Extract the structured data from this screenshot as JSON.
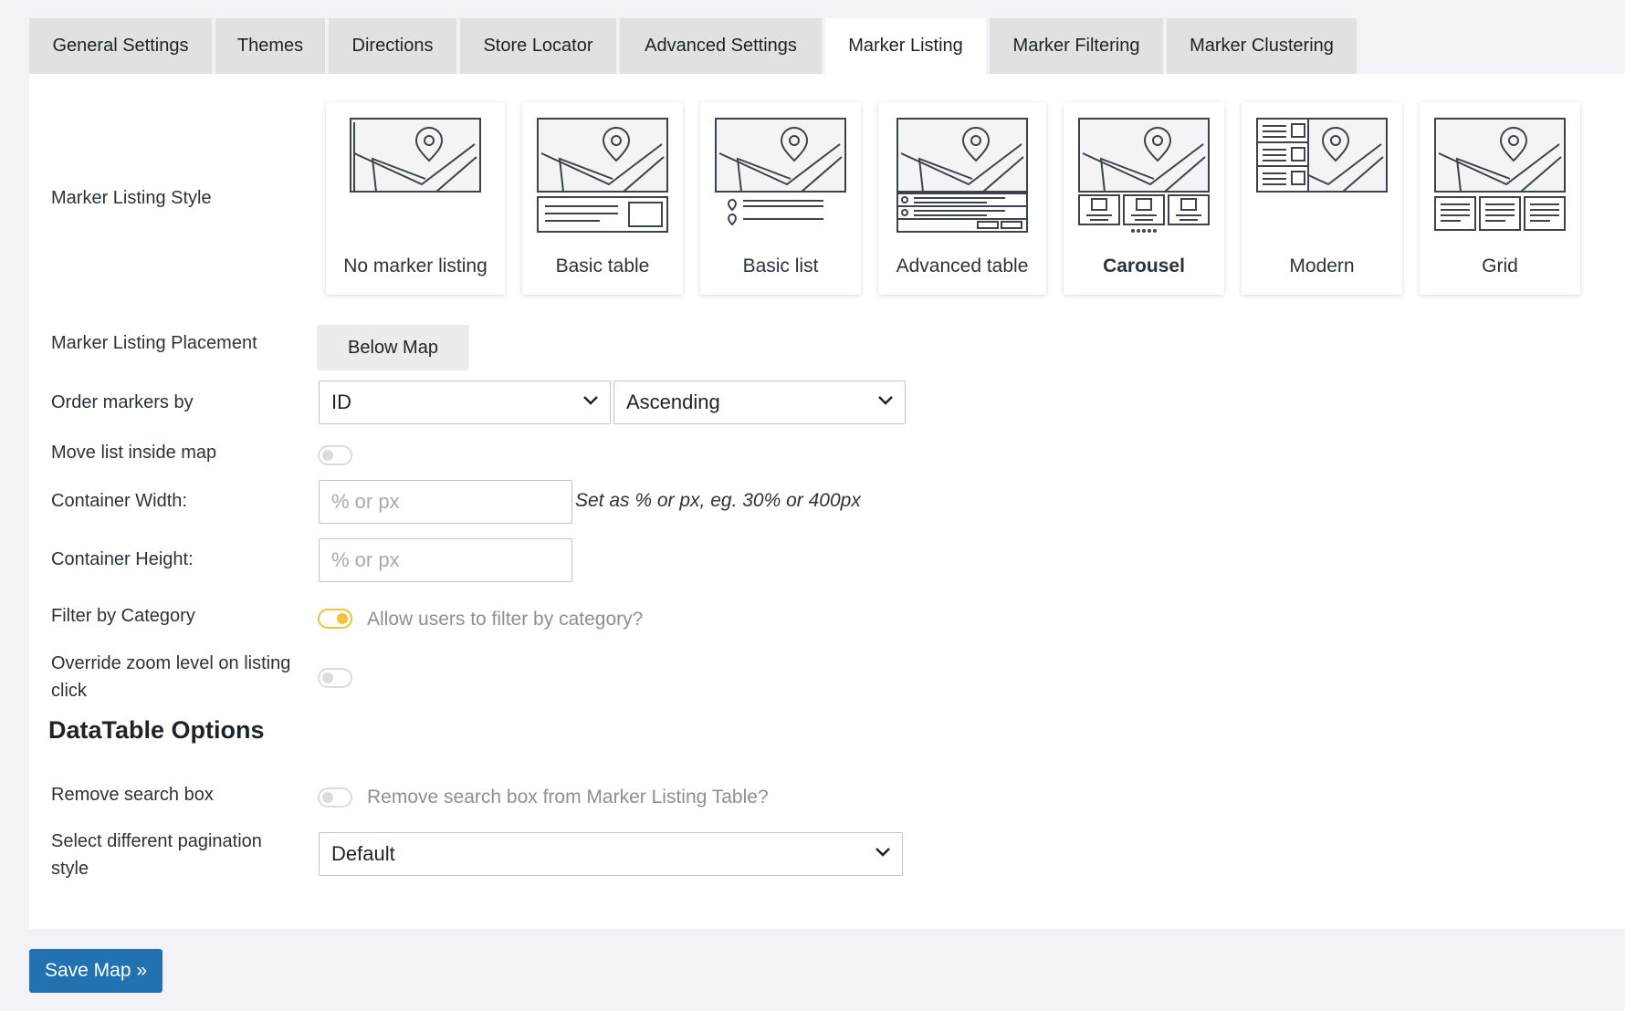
{
  "tabs": [
    {
      "label": "General Settings"
    },
    {
      "label": "Themes"
    },
    {
      "label": "Directions"
    },
    {
      "label": "Store Locator"
    },
    {
      "label": "Advanced Settings"
    },
    {
      "label": "Marker Listing",
      "active": true
    },
    {
      "label": "Marker Filtering"
    },
    {
      "label": "Marker Clustering"
    }
  ],
  "listing_style": {
    "label": "Marker Listing Style",
    "selected": "Carousel",
    "options": [
      {
        "label": "No marker listing",
        "icon": "map-only-icon"
      },
      {
        "label": "Basic table",
        "icon": "map-basic-table-icon"
      },
      {
        "label": "Basic list",
        "icon": "map-basic-list-icon"
      },
      {
        "label": "Advanced table",
        "icon": "map-advanced-table-icon"
      },
      {
        "label": "Carousel",
        "icon": "map-carousel-icon"
      },
      {
        "label": "Modern",
        "icon": "map-modern-icon"
      },
      {
        "label": "Grid",
        "icon": "map-grid-icon"
      }
    ]
  },
  "placement": {
    "label": "Marker Listing Placement",
    "button": "Below Map"
  },
  "order": {
    "label": "Order markers by",
    "field_value": "ID",
    "direction_value": "Ascending"
  },
  "move_inside": {
    "label": "Move list inside map",
    "enabled": false
  },
  "container_width": {
    "label": "Container Width:",
    "placeholder": "% or px",
    "hint": "Set as % or px, eg. 30% or 400px"
  },
  "container_height": {
    "label": "Container Height:",
    "placeholder": "% or px"
  },
  "filter_category": {
    "label": "Filter by Category",
    "enabled": true,
    "description": "Allow users to filter by category?"
  },
  "override_zoom": {
    "label": "Override zoom level on listing click",
    "enabled": false
  },
  "datatable": {
    "title": "DataTable Options",
    "remove_search": {
      "label": "Remove search box",
      "enabled": false,
      "description": "Remove search box from Marker Listing Table?"
    },
    "pagination": {
      "label": "Select different pagination style",
      "value": "Default"
    }
  },
  "save_button": "Save Map »",
  "colors": {
    "accent": "#2271b1",
    "toggle_on": "#f0c33c",
    "tab_bg": "#e1e1e3",
    "page_bg": "#f3f3f7"
  }
}
